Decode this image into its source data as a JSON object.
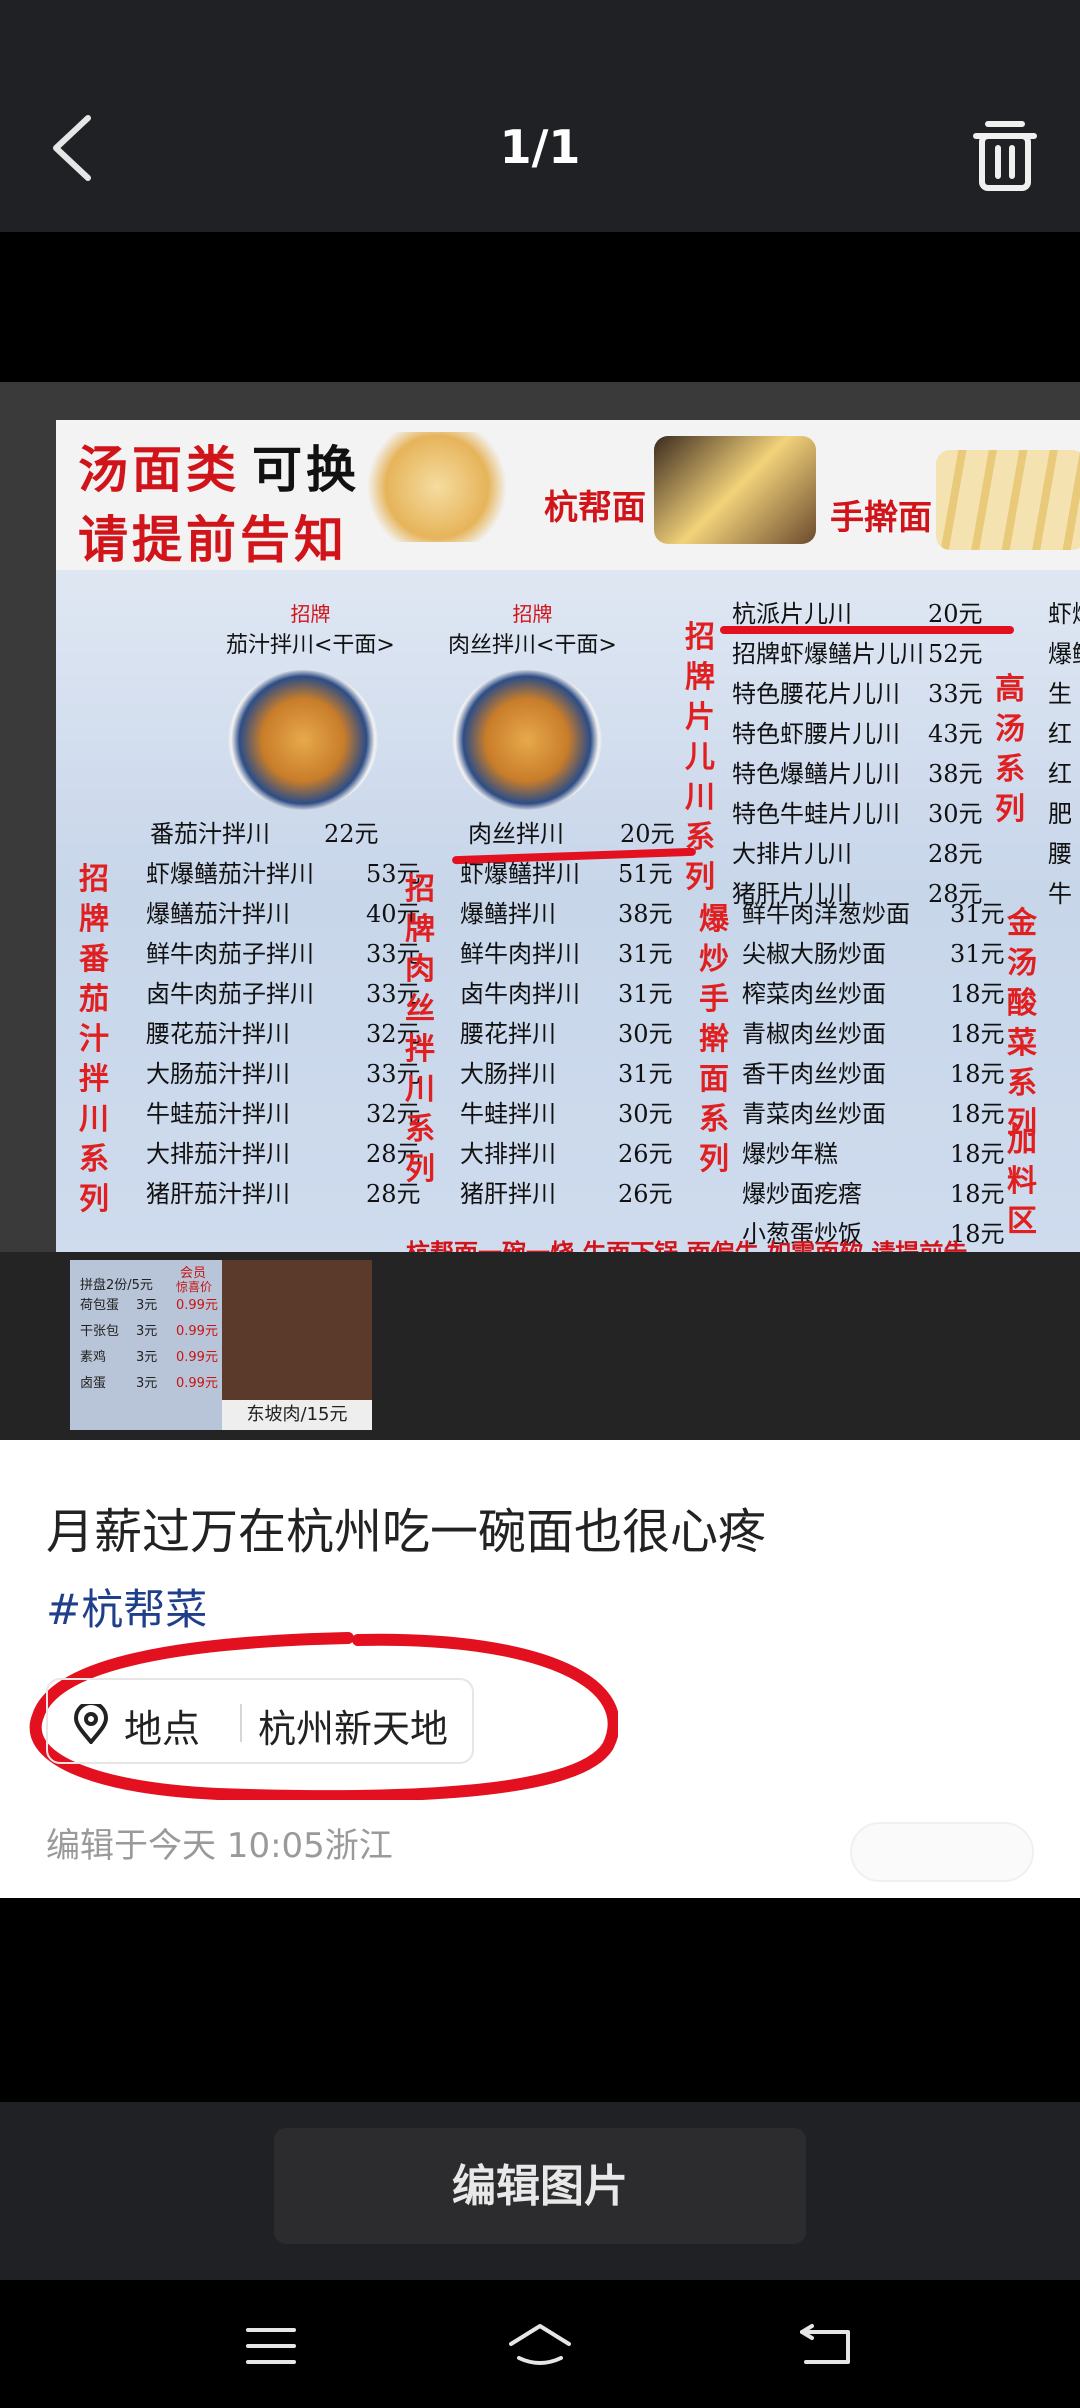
{
  "header": {
    "counter": "1/1",
    "back_icon": "chevron-left-icon",
    "delete_icon": "trash-icon"
  },
  "photo": {
    "banner": {
      "line1_red": "汤面类",
      "line1_black": "可换",
      "line2": "请提前告知",
      "label1": "杭帮面",
      "label2": "手擀面"
    },
    "board": {
      "col1_head_tag": "招牌",
      "col1_head": "茄汁拌川<干面>",
      "col2_head_tag": "招牌",
      "col2_head": "肉丝拌川<干面>",
      "col1_top": [
        {
          "name": "番茄汁拌川",
          "price": "22元"
        }
      ],
      "col2_top": [
        {
          "name": "肉丝拌川",
          "price": "20元"
        }
      ],
      "vert1": "招牌番茄汁拌川系列",
      "vert2": "招牌肉丝拌川系列",
      "vert3": "招牌片儿川系列",
      "vert4": "爆炒手擀面系列",
      "vert5": "高汤系列",
      "vert6": "金汤酸菜系列",
      "vert7": "加料区",
      "col1": [
        {
          "name": "虾爆鳝茄汁拌川",
          "price": "53元"
        },
        {
          "name": "爆鳝茄汁拌川",
          "price": "40元"
        },
        {
          "name": "鲜牛肉茄子拌川",
          "price": "33元"
        },
        {
          "name": "卤牛肉茄子拌川",
          "price": "33元"
        },
        {
          "name": "腰花茄汁拌川",
          "price": "32元"
        },
        {
          "name": "大肠茄汁拌川",
          "price": "33元"
        },
        {
          "name": "牛蛙茄汁拌川",
          "price": "32元"
        },
        {
          "name": "大排茄汁拌川",
          "price": "28元"
        },
        {
          "name": "猪肝茄汁拌川",
          "price": "28元"
        }
      ],
      "col2": [
        {
          "name": "虾爆鳝拌川",
          "price": "51元"
        },
        {
          "name": "爆鳝拌川",
          "price": "38元"
        },
        {
          "name": "鲜牛肉拌川",
          "price": "31元"
        },
        {
          "name": "卤牛肉拌川",
          "price": "31元"
        },
        {
          "name": "腰花拌川",
          "price": "30元"
        },
        {
          "name": "大肠拌川",
          "price": "31元"
        },
        {
          "name": "牛蛙拌川",
          "price": "30元"
        },
        {
          "name": "大排拌川",
          "price": "26元"
        },
        {
          "name": "猪肝拌川",
          "price": "26元"
        }
      ],
      "col3": [
        {
          "name": "杭派片儿川",
          "price": "20元"
        },
        {
          "name": "招牌虾爆鳝片儿川",
          "price": "52元"
        },
        {
          "name": "特色腰花片儿川",
          "price": "33元"
        },
        {
          "name": "特色虾腰片儿川",
          "price": "43元"
        },
        {
          "name": "特色爆鳝片儿川",
          "price": "38元"
        },
        {
          "name": "特色牛蛙片儿川",
          "price": "30元"
        },
        {
          "name": "大排片儿川",
          "price": "28元"
        },
        {
          "name": "猪肝片儿川",
          "price": "28元"
        }
      ],
      "col4": [
        {
          "name": "鲜牛肉洋葱炒面",
          "price": "31元"
        },
        {
          "name": "尖椒大肠炒面",
          "price": "31元"
        },
        {
          "name": "榨菜肉丝炒面",
          "price": "18元"
        },
        {
          "name": "青椒肉丝炒面",
          "price": "18元"
        },
        {
          "name": "香干肉丝炒面",
          "price": "18元"
        },
        {
          "name": "青菜肉丝炒面",
          "price": "18元"
        },
        {
          "name": "爆炒年糕",
          "price": "18元"
        },
        {
          "name": "爆炒面疙瘩",
          "price": "18元"
        },
        {
          "name": "小葱蛋炒饭",
          "price": "18元"
        }
      ],
      "col5": [
        "虾爆",
        "爆鳝",
        "生",
        "红",
        "红",
        "肥",
        "腰",
        "牛"
      ],
      "footer": "杭帮面一碗一烧  生面下锅 面偏生   如需面软 请提前告"
    },
    "card": {
      "line1": "拼盘2份/5元",
      "member": "会员",
      "member2": "惊喜价",
      "rows": [
        {
          "name": "荷包蛋",
          "price": "3元",
          "mp": "0.99元"
        },
        {
          "name": "干张包",
          "price": "3元",
          "mp": "0.99元"
        },
        {
          "name": "素鸡",
          "price": "3元",
          "mp": "0.99元"
        },
        {
          "name": "卤蛋",
          "price": "3元",
          "mp": "0.99元"
        }
      ],
      "caption": "东坡肉/15元"
    }
  },
  "post": {
    "title": "月薪过万在杭州吃一碗面也很心疼",
    "hashtag": "#杭帮菜",
    "location_label": "地点",
    "location_value": "杭州新天地",
    "meta": "编辑于今天 10:05浙江"
  },
  "actions": {
    "edit_label": "编辑图片"
  },
  "nav": {
    "menu_icon": "menu-icon",
    "home_icon": "home-icon",
    "back_icon": "back-icon"
  },
  "colors": {
    "accent_red": "#e3101f",
    "topbar": "#202124",
    "hashtag_blue": "#1f3f8a"
  }
}
